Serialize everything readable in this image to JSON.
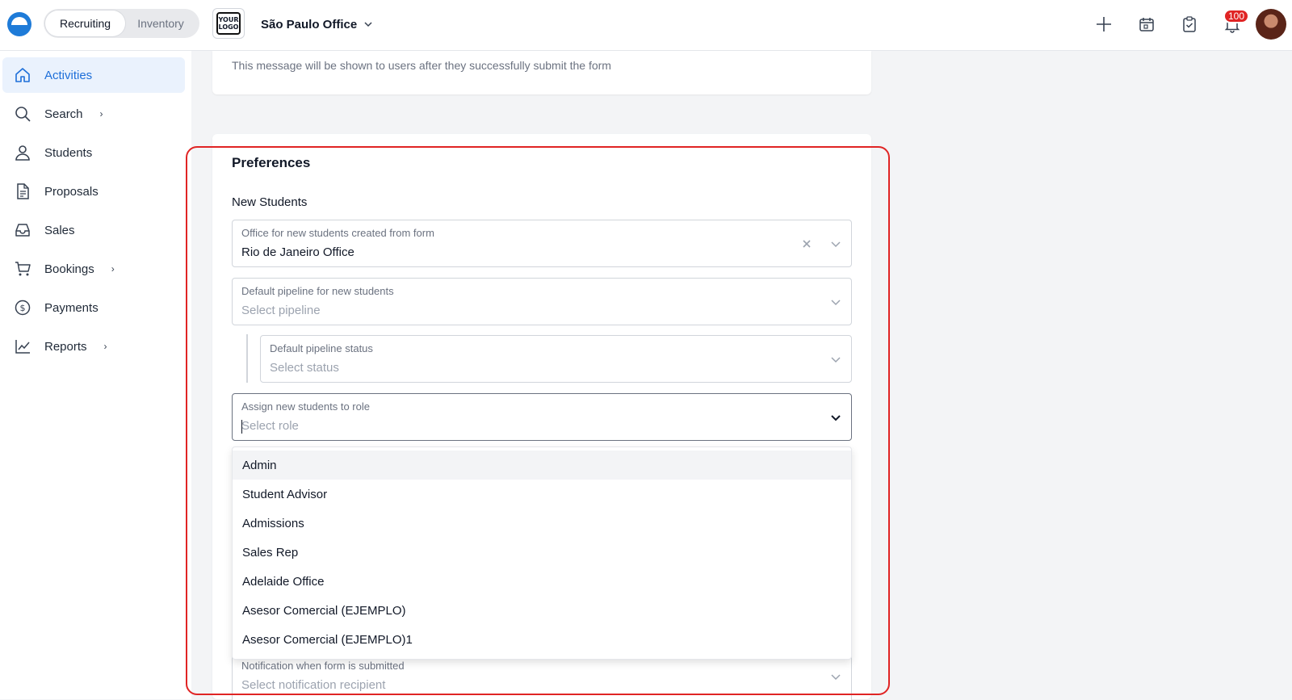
{
  "header": {
    "modes": [
      "Recruiting",
      "Inventory"
    ],
    "active_mode": "Recruiting",
    "logo_text": "YOUR LOGO",
    "office": "São Paulo Office",
    "notification_count": "100"
  },
  "sidebar": {
    "items": [
      {
        "label": "Activities",
        "icon": "home-icon",
        "active": true
      },
      {
        "label": "Search",
        "icon": "search-icon",
        "chevron": "›"
      },
      {
        "label": "Students",
        "icon": "user-icon"
      },
      {
        "label": "Proposals",
        "icon": "document-icon"
      },
      {
        "label": "Sales",
        "icon": "inbox-icon"
      },
      {
        "label": "Bookings",
        "icon": "cart-icon",
        "chevron": "›"
      },
      {
        "label": "Payments",
        "icon": "dollar-icon"
      },
      {
        "label": "Reports",
        "icon": "chart-line-icon",
        "chevron": "›"
      }
    ]
  },
  "main": {
    "success_message": "This message will be shown to users after they successfully submit the form",
    "preferences_title": "Preferences",
    "new_students_title": "New Students",
    "fields": {
      "office": {
        "label": "Office for new students created from form",
        "value": "Rio de Janeiro Office"
      },
      "pipeline": {
        "label": "Default pipeline for new students",
        "placeholder": "Select pipeline"
      },
      "status": {
        "label": "Default pipeline status",
        "placeholder": "Select status"
      },
      "role": {
        "label": "Assign new students to role",
        "placeholder": "Select role"
      },
      "notification": {
        "label": "Notification when form is submitted",
        "placeholder": "Select notification recipient"
      }
    },
    "role_options": [
      "Admin",
      "Student Advisor",
      "Admissions",
      "Sales Rep",
      "Adelaide Office",
      "Asesor Comercial (EJEMPLO)",
      "Asesor Comercial (EJEMPLO)1"
    ]
  },
  "colors": {
    "accent": "#1e6fd9",
    "highlight": "#e02424",
    "badge": "#e02424"
  }
}
